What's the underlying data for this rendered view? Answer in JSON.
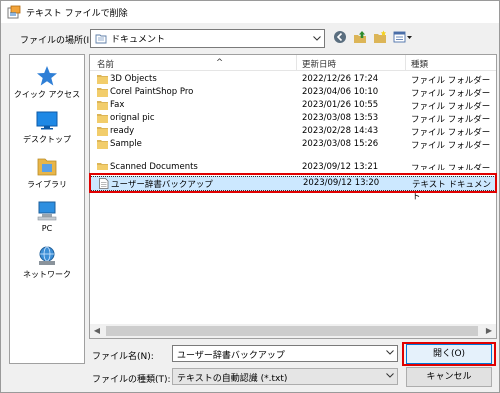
{
  "window": {
    "title": "テキスト ファイルで削除"
  },
  "location": {
    "label": "ファイルの場所(I):",
    "value": "ドキュメント",
    "icons": [
      "back-arrow-icon",
      "up-folder-icon",
      "new-folder-icon",
      "view-menu-icon"
    ]
  },
  "places": [
    {
      "label": "クイック アクセス",
      "icon": "star-icon"
    },
    {
      "label": "デスクトップ",
      "icon": "desktop-icon"
    },
    {
      "label": "ライブラリ",
      "icon": "library-icon"
    },
    {
      "label": "PC",
      "icon": "pc-icon"
    },
    {
      "label": "ネットワーク",
      "icon": "network-icon"
    }
  ],
  "columns": {
    "name": "名前",
    "date": "更新日時",
    "type": "種類"
  },
  "files": [
    {
      "name": "3D Objects",
      "date": "2022/12/26 17:24",
      "type": "ファイル フォルダー",
      "kind": "folder"
    },
    {
      "name": "Corel PaintShop Pro",
      "date": "2023/04/06 10:10",
      "type": "ファイル フォルダー",
      "kind": "folder"
    },
    {
      "name": "Fax",
      "date": "2023/01/26 10:55",
      "type": "ファイル フォルダー",
      "kind": "folder"
    },
    {
      "name": "orignal pic",
      "date": "2023/03/08 13:53",
      "type": "ファイル フォルダー",
      "kind": "folder"
    },
    {
      "name": "ready",
      "date": "2023/02/28 14:43",
      "type": "ファイル フォルダー",
      "kind": "folder"
    },
    {
      "name": "Sample",
      "date": "2023/03/08 15:26",
      "type": "ファイル フォルダー",
      "kind": "folder"
    },
    {
      "name": "Scanned Documents",
      "date": "2023/09/12 13:21",
      "type": "ファイル フォルダー",
      "kind": "folder"
    },
    {
      "name": "ユーザー辞書バックアップ",
      "date": "2023/09/12 13:20",
      "type": "テキスト ドキュメント",
      "kind": "text"
    }
  ],
  "filename": {
    "label": "ファイル名(N):",
    "value": "ユーザー辞書バックアップ"
  },
  "filetype": {
    "label": "ファイルの種類(T):",
    "value": "テキストの自動認識 (*.txt)"
  },
  "buttons": {
    "open": "開く(O)",
    "cancel": "キャンセル"
  },
  "colors": {
    "selection": "#cce8ff",
    "callout": "#e00000",
    "folder": "#dcb557"
  }
}
